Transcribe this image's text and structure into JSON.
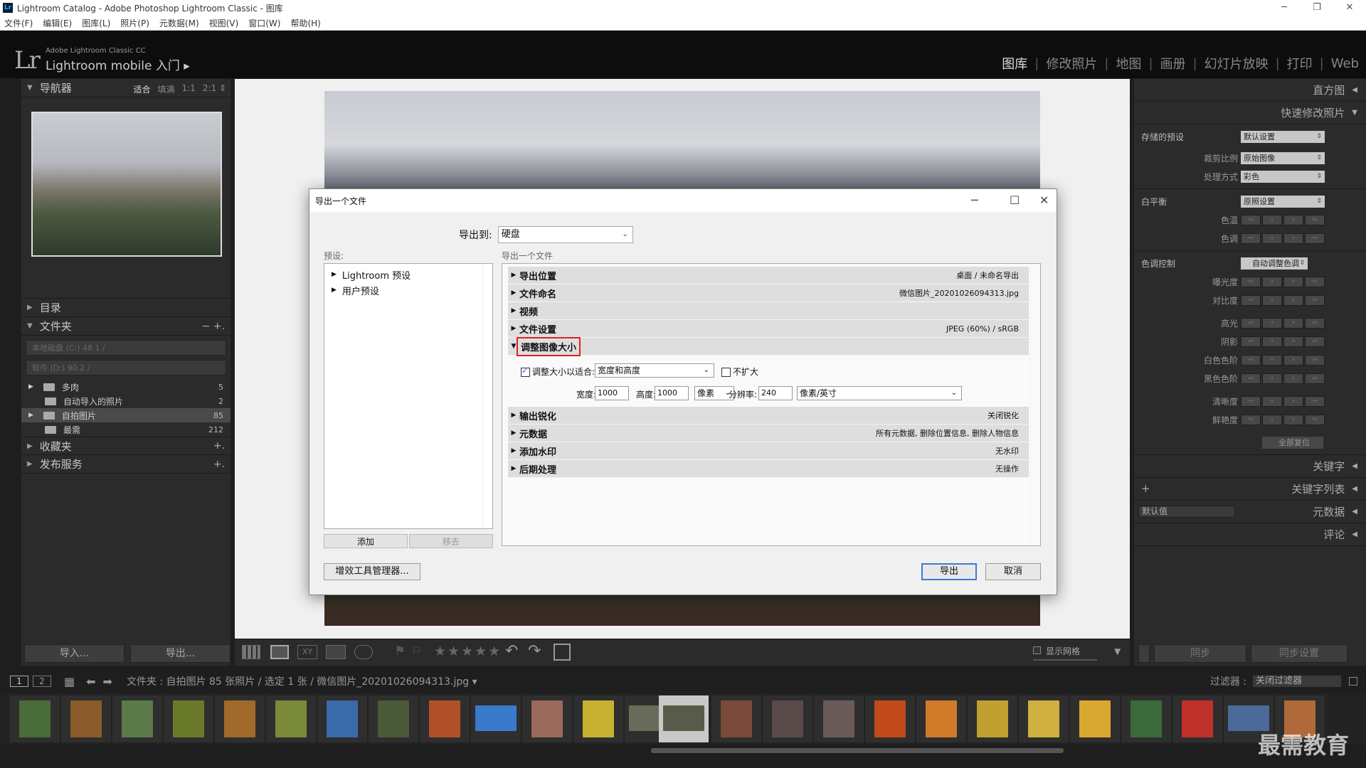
{
  "window": {
    "title": "Lightroom Catalog - Adobe Photoshop Lightroom Classic - 图库",
    "controls": [
      "─",
      "❐",
      "✕"
    ]
  },
  "menu": [
    "文件(F)",
    "编辑(E)",
    "图库(L)",
    "照片(P)",
    "元数据(M)",
    "视图(V)",
    "窗口(W)",
    "帮助(H)"
  ],
  "identity": {
    "logo": "Lr",
    "small": "Adobe Lightroom Classic CC",
    "big": "Lightroom mobile 入门 ▸"
  },
  "modules": [
    "图库",
    "修改照片",
    "地图",
    "画册",
    "幻灯片放映",
    "打印",
    "Web"
  ],
  "left": {
    "navigator": {
      "title": "导航器",
      "zoom": [
        "适合",
        "填满",
        "1:1",
        "2:1 ⇕"
      ]
    },
    "catalog": "目录",
    "folders": {
      "title": "文件夹",
      "actions": "−  +.",
      "vol1": "本地磁盘 (C:)     48.1 /",
      "vol2": "软件 (D:)         90.2 /",
      "items": [
        {
          "name": "多肉",
          "count": "5"
        },
        {
          "name": "自动导入的照片",
          "count": "2"
        },
        {
          "name": "自拍图片",
          "count": "85"
        },
        {
          "name": "最需",
          "count": "212"
        }
      ]
    },
    "collections": "收藏夹",
    "publish": "发布服务",
    "import": "导入...",
    "export": "导出..."
  },
  "right": {
    "histogram": "直方图",
    "quickdev": "快速修改照片",
    "saved_preset": {
      "label": "存储的预设",
      "value": "默认设置"
    },
    "crop": {
      "label": "裁剪比例",
      "value": "原始图像"
    },
    "treatment": {
      "label": "处理方式",
      "value": "彩色"
    },
    "wb": {
      "label": "白平衡",
      "value": "原照设置"
    },
    "temp": "色温",
    "tint": "色调",
    "tone": {
      "label": "色调控制",
      "value": "自动调整色调"
    },
    "tone_items": [
      "曝光度",
      "对比度",
      "高光",
      "阴影",
      "白色色阶",
      "黑色色阶",
      "清晰度",
      "鲜艳度"
    ],
    "reset_all": "全部复位",
    "keywording": "关键字",
    "keyword_list": "关键字列表",
    "metadata_default": "默认值",
    "metadata": "元数据",
    "comments": "评论",
    "sync": "同步",
    "sync_settings": "同步设置"
  },
  "toolbar": {
    "grid_overlay": "显示网格"
  },
  "filmstrip": {
    "pages": [
      "1",
      "2"
    ],
    "path": "文件夹 : 自拍图片    85 张照片 / 选定 1 张 / 微信图片_20201026094313.jpg ▾",
    "filter_label": "过滤器 :",
    "filter_value": "关闭过滤器"
  },
  "watermark": "最需教育",
  "dialog": {
    "title": "导出一个文件",
    "export_to_label": "导出到:",
    "export_to_value": "硬盘",
    "presets_label": "预设:",
    "presets": [
      "Lightroom 预设",
      "用户预设"
    ],
    "add": "添加",
    "remove": "移去",
    "main_label": "导出一个文件",
    "sections": [
      {
        "name": "导出位置",
        "summary": "桌面 / 未命名导出"
      },
      {
        "name": "文件命名",
        "summary": "微信图片_20201026094313.jpg"
      },
      {
        "name": "视频",
        "summary": ""
      },
      {
        "name": "文件设置",
        "summary": "JPEG (60%) / sRGB"
      },
      {
        "name": "调整图像大小",
        "summary": ""
      }
    ],
    "resize": {
      "fit_label": "调整大小以适合:",
      "fit_value": "宽度和高度",
      "no_enlarge": "不扩大",
      "w_label": "宽度:",
      "w": "1000",
      "h_label": "高度:",
      "h": "1000",
      "unit": "像素",
      "res_label": "分辨率:",
      "res": "240",
      "res_unit": "像素/英寸"
    },
    "sections2": [
      {
        "name": "输出锐化",
        "summary": "关闭锐化"
      },
      {
        "name": "元数据",
        "summary": "所有元数据, 删除位置信息, 删除人物信息"
      },
      {
        "name": "添加水印",
        "summary": "无水印"
      },
      {
        "name": "后期处理",
        "summary": "无操作"
      }
    ],
    "plugin_manager": "增效工具管理器...",
    "export_btn": "导出",
    "cancel_btn": "取消"
  }
}
